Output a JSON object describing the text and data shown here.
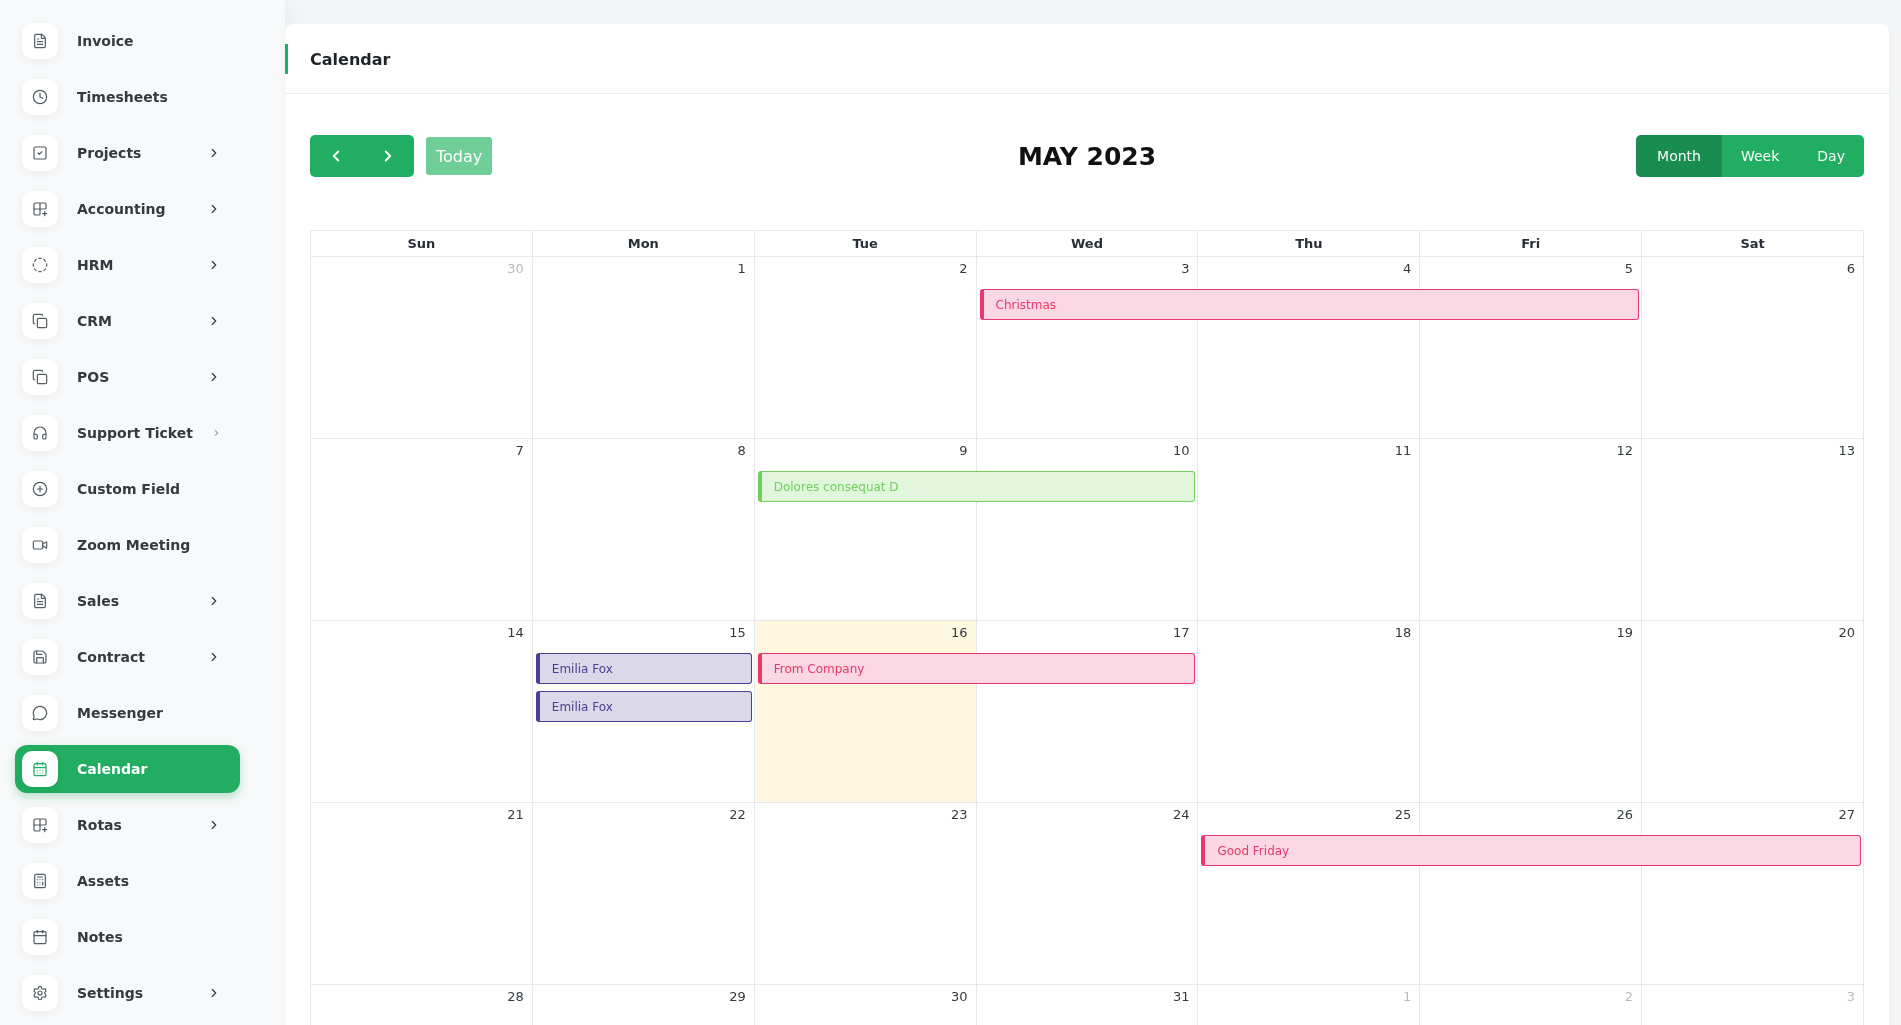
{
  "sidebar": {
    "items": [
      {
        "label": "Invoice",
        "has_submenu": false,
        "selected": false
      },
      {
        "label": "Timesheets",
        "has_submenu": false,
        "selected": false
      },
      {
        "label": "Projects",
        "has_submenu": true,
        "selected": false
      },
      {
        "label": "Accounting",
        "has_submenu": true,
        "selected": false
      },
      {
        "label": "HRM",
        "has_submenu": true,
        "selected": false
      },
      {
        "label": "CRM",
        "has_submenu": true,
        "selected": false
      },
      {
        "label": "POS",
        "has_submenu": true,
        "selected": false
      },
      {
        "label": "Support Ticket",
        "has_submenu": true,
        "selected": false
      },
      {
        "label": "Custom Field",
        "has_submenu": false,
        "selected": false
      },
      {
        "label": "Zoom Meeting",
        "has_submenu": false,
        "selected": false
      },
      {
        "label": "Sales",
        "has_submenu": true,
        "selected": false
      },
      {
        "label": "Contract",
        "has_submenu": true,
        "selected": false
      },
      {
        "label": "Messenger",
        "has_submenu": false,
        "selected": false
      },
      {
        "label": "Calendar",
        "has_submenu": false,
        "selected": true
      },
      {
        "label": "Rotas",
        "has_submenu": true,
        "selected": false
      },
      {
        "label": "Assets",
        "has_submenu": false,
        "selected": false
      },
      {
        "label": "Notes",
        "has_submenu": false,
        "selected": false
      },
      {
        "label": "Settings",
        "has_submenu": true,
        "selected": false
      }
    ]
  },
  "page_title": "Calendar",
  "toolbar": {
    "today_button": "Today",
    "month_title": "MAY 2023",
    "views": [
      {
        "label": "Month",
        "selected": true
      },
      {
        "label": "Week",
        "selected": false
      },
      {
        "label": "Day",
        "selected": false
      }
    ]
  },
  "weekdays": [
    "Sun",
    "Mon",
    "Tue",
    "Wed",
    "Thu",
    "Fri",
    "Sat"
  ],
  "weeks": [
    {
      "days": [
        {
          "label": "30",
          "muted": true,
          "today": false
        },
        {
          "label": "1",
          "muted": false,
          "today": false
        },
        {
          "label": "2",
          "muted": false,
          "today": false
        },
        {
          "label": "3",
          "muted": false,
          "today": false,
          "events": [
            {
              "kind": "start",
              "title": "Christmas",
              "color": "#e8386d"
            }
          ]
        },
        {
          "label": "4",
          "muted": false,
          "today": false,
          "events": [
            {
              "kind": "continued"
            }
          ]
        },
        {
          "label": "5",
          "muted": false,
          "today": false,
          "events": [
            {
              "kind": "continued"
            }
          ]
        },
        {
          "label": "6",
          "muted": false,
          "today": false
        }
      ]
    },
    {
      "days": [
        {
          "label": "7",
          "muted": false,
          "today": false
        },
        {
          "label": "8",
          "muted": false,
          "today": false
        },
        {
          "label": "9",
          "muted": false,
          "today": false,
          "events": [
            {
              "kind": "start",
              "title": "Dolores consequat D",
              "color": "#6fd05c"
            }
          ]
        },
        {
          "label": "10",
          "muted": false,
          "today": false,
          "events": [
            {
              "kind": "continued"
            }
          ]
        },
        {
          "label": "11",
          "muted": false,
          "today": false
        },
        {
          "label": "12",
          "muted": false,
          "today": false
        },
        {
          "label": "13",
          "muted": false,
          "today": false
        }
      ]
    },
    {
      "days": [
        {
          "label": "14",
          "muted": false,
          "today": false
        },
        {
          "label": "15",
          "muted": false,
          "today": false,
          "events": [
            {
              "kind": "start",
              "title": "Emilia Fox",
              "color": "#4b3f91"
            },
            {
              "kind": "start",
              "title": "Emilia Fox",
              "color": "#4b3f91"
            }
          ]
        },
        {
          "label": "16",
          "muted": false,
          "today": true,
          "events": [
            {
              "kind": "start",
              "title": "From Company",
              "color": "#e8386d"
            }
          ]
        },
        {
          "label": "17",
          "muted": false,
          "today": false,
          "events": [
            {
              "kind": "continued"
            }
          ]
        },
        {
          "label": "18",
          "muted": false,
          "today": false
        },
        {
          "label": "19",
          "muted": false,
          "today": false
        },
        {
          "label": "20",
          "muted": false,
          "today": false
        }
      ]
    },
    {
      "days": [
        {
          "label": "21",
          "muted": false,
          "today": false
        },
        {
          "label": "22",
          "muted": false,
          "today": false
        },
        {
          "label": "23",
          "muted": false,
          "today": false
        },
        {
          "label": "24",
          "muted": false,
          "today": false
        },
        {
          "label": "25",
          "muted": false,
          "today": false,
          "events": [
            {
              "kind": "start",
              "title": "Good Friday",
              "color": "#e8386d"
            }
          ]
        },
        {
          "label": "26",
          "muted": false,
          "today": false,
          "events": [
            {
              "kind": "continued"
            }
          ]
        },
        {
          "label": "27",
          "muted": false,
          "today": false,
          "events": [
            {
              "kind": "continued"
            }
          ]
        }
      ]
    },
    {
      "days": [
        {
          "label": "28",
          "muted": false,
          "today": false
        },
        {
          "label": "29",
          "muted": false,
          "today": false
        },
        {
          "label": "30",
          "muted": false,
          "today": false
        },
        {
          "label": "31",
          "muted": false,
          "today": false
        },
        {
          "label": "1",
          "muted": true,
          "today": false
        },
        {
          "label": "2",
          "muted": true,
          "today": false
        },
        {
          "label": "3",
          "muted": true,
          "today": false
        }
      ]
    }
  ]
}
